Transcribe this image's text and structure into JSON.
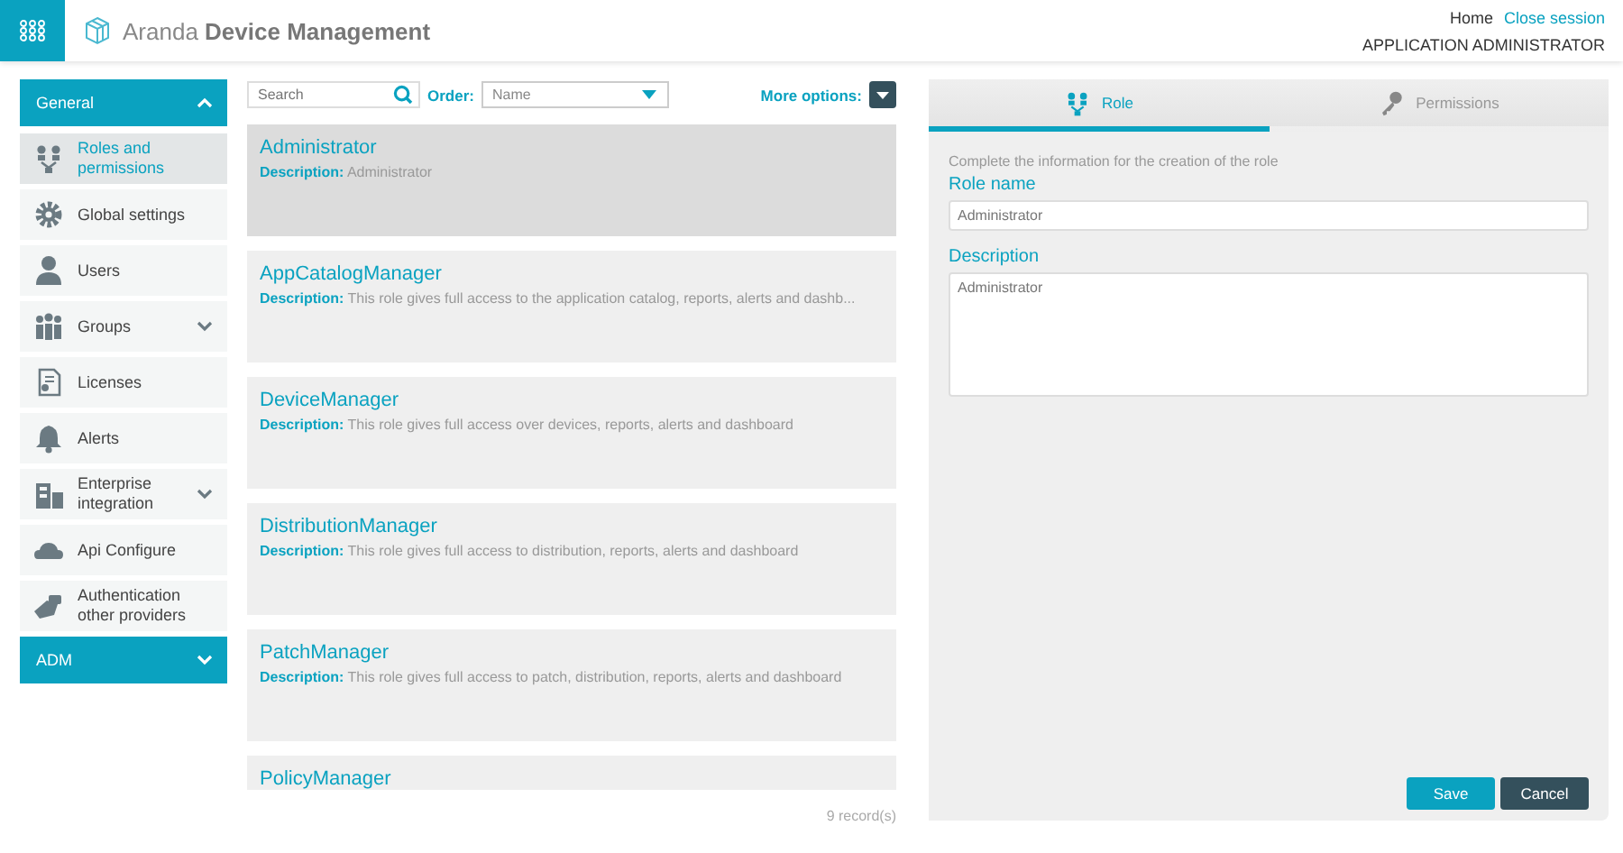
{
  "header": {
    "app_name_light": "Aranda",
    "app_name_bold": "Device Management",
    "links": [
      {
        "label": "Home",
        "kind": "plain"
      },
      {
        "label": "Close session",
        "kind": "accent"
      }
    ],
    "user_role": "APPLICATION ADMINISTRATOR"
  },
  "sidebar": {
    "sections": [
      {
        "title": "General",
        "expanded": true,
        "items": [
          {
            "label": "Roles and permissions",
            "selected": true,
            "kind": "link"
          },
          {
            "label": "Global settings",
            "selected": false,
            "kind": "link"
          },
          {
            "label": "Users",
            "selected": false,
            "kind": "link"
          },
          {
            "label": "Groups",
            "selected": false,
            "kind": "submenu"
          },
          {
            "label": "Licenses",
            "selected": false,
            "kind": "link"
          },
          {
            "label": "Alerts",
            "selected": false,
            "kind": "link"
          },
          {
            "label": "Enterprise integration",
            "selected": false,
            "kind": "submenu"
          },
          {
            "label": "Api Configure",
            "selected": false,
            "kind": "link"
          },
          {
            "label": "Authentication other providers",
            "selected": false,
            "kind": "link"
          }
        ]
      },
      {
        "title": "ADM",
        "expanded": false
      }
    ]
  },
  "list": {
    "search": {
      "placeholder": "Search"
    },
    "order_label": "Order:",
    "order_value": "Name",
    "more_options": "More options:",
    "roles": [
      {
        "name": "Administrator",
        "description_label": "Description:",
        "description": "Administrator",
        "selected": true
      },
      {
        "name": "AppCatalogManager",
        "description_label": "Description:",
        "description": "This role gives full access to the application catalog, reports, alerts and dashb...",
        "selected": false
      },
      {
        "name": "DeviceManager",
        "description_label": "Description:",
        "description": "This role gives full access over devices, reports, alerts and dashboard",
        "selected": false
      },
      {
        "name": "DistributionManager",
        "description_label": "Description:",
        "description": "This role gives full access to distribution, reports, alerts and dashboard",
        "selected": false
      },
      {
        "name": "PatchManager",
        "description_label": "Description:",
        "description": "This role gives full access to patch, distribution, reports, alerts and dashboard",
        "selected": false
      },
      {
        "name": "PolicyManager",
        "selected": false
      }
    ],
    "record_count": "9 record(s)"
  },
  "detail": {
    "tabs": [
      {
        "label": "Role",
        "selected": true
      },
      {
        "label": "Permissions",
        "selected": false
      }
    ],
    "intro": "Complete the information for the creation of the role",
    "fields": [
      {
        "label": "Role name",
        "value": "Administrator",
        "kind": "input"
      },
      {
        "label": "Description",
        "value": "Administrator",
        "kind": "textarea"
      }
    ],
    "buttons": [
      {
        "label": "Save",
        "kind": "primary"
      },
      {
        "label": "Cancel",
        "kind": "secondary"
      }
    ]
  }
}
